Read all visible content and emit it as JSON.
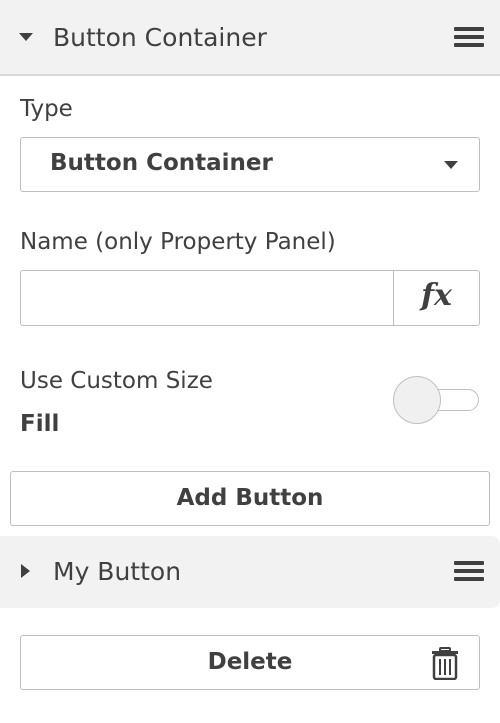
{
  "section": {
    "title": "Button Container"
  },
  "type_field": {
    "label": "Type",
    "value": "Button Container"
  },
  "name_field": {
    "label": "Name (only Property Panel)",
    "value": "",
    "fx_label": "fx"
  },
  "custom_size": {
    "label": "Use Custom Size",
    "enabled": false,
    "value_text": "Fill"
  },
  "add_button": {
    "label": "Add Button"
  },
  "item": {
    "title": "My Button"
  },
  "delete_button": {
    "label": "Delete"
  },
  "colors": {
    "header_bg": "#f2f2f2",
    "text": "#404040",
    "border": "#bfbfbf"
  },
  "icons": [
    "caret-down-icon",
    "hamburger-menu-icon",
    "dropdown-caret-icon",
    "fx-icon",
    "caret-right-icon",
    "trash-icon"
  ]
}
